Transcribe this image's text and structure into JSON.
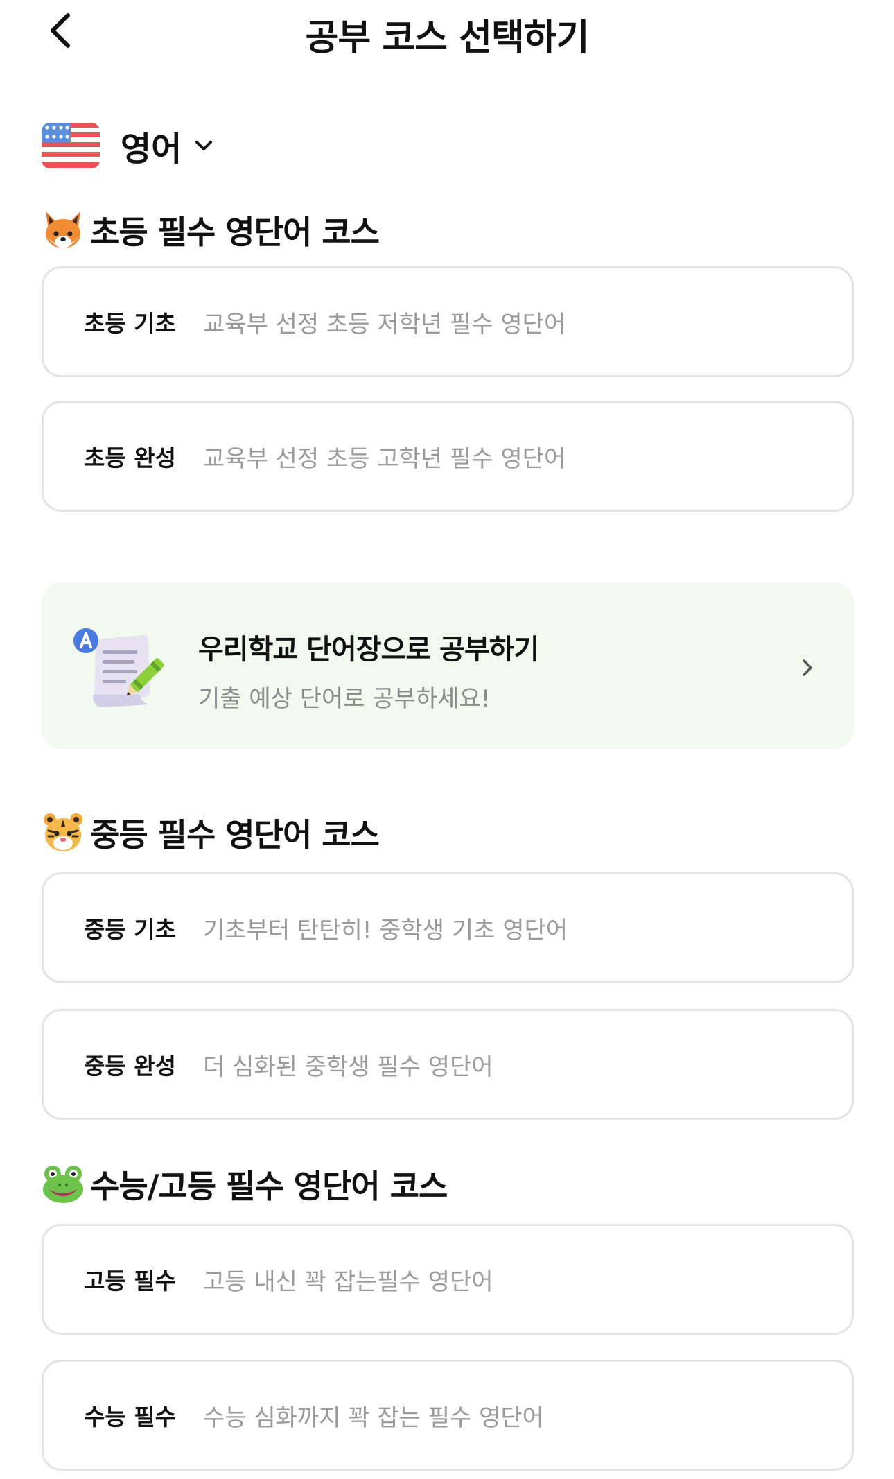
{
  "header": {
    "title": "공부 코스 선택하기",
    "back_icon": "chevron-left-icon"
  },
  "language": {
    "label": "영어",
    "flag_icon": "us-flag-icon",
    "dropdown_icon": "chevron-down-icon"
  },
  "sections": [
    {
      "emoji": "fox-emoji-icon",
      "title": "초등 필수 영단어 코스",
      "courses": [
        {
          "name": "초등 기초",
          "desc": "교육부 선정 초등 저학년 필수 영단어"
        },
        {
          "name": "초등 완성",
          "desc": "교육부 선정 초등 고학년 필수 영단어"
        }
      ]
    },
    {
      "emoji": "tiger-emoji-icon",
      "title": "중등 필수 영단어 코스",
      "courses": [
        {
          "name": "중등 기초",
          "desc": "기초부터 탄탄히! 중학생 기초 영단어"
        },
        {
          "name": "중등 완성",
          "desc": "더 심화된 중학생 필수 영단어"
        }
      ]
    },
    {
      "emoji": "frog-emoji-icon",
      "title": "수능/고등 필수 영단어 코스",
      "courses": [
        {
          "name": "고등 필수",
          "desc": "고등 내신 꽉 잡는필수 영단어"
        },
        {
          "name": "수능 필수",
          "desc": "수능 심화까지 꽉 잡는 필수 영단어"
        }
      ]
    }
  ],
  "promo": {
    "title": "우리학교 단어장으로 공부하기",
    "subtitle": "기출 예상 단어로 공부하세요!",
    "icon": "document-pencil-icon",
    "arrow_icon": "chevron-right-icon"
  },
  "colors": {
    "card_border": "#e3e3e3",
    "promo_background": "#f2faf0",
    "secondary_text": "#9a9a9a"
  }
}
